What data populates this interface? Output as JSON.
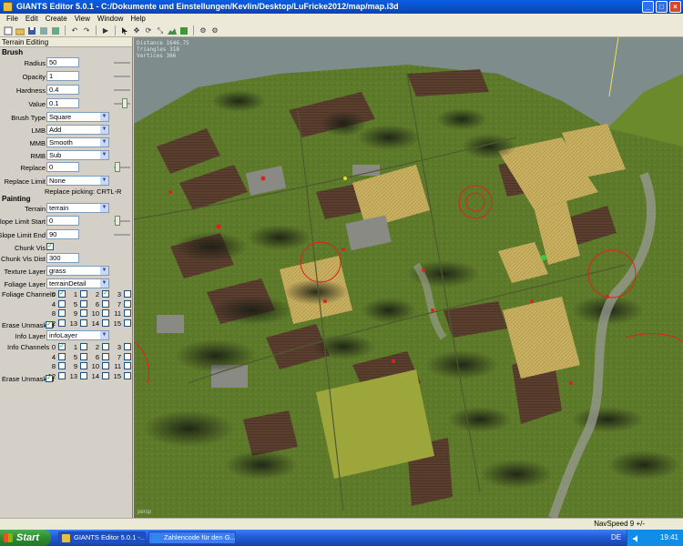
{
  "window": {
    "title": "GIANTS Editor 5.0.1 - C:/Dokumente und Einstellungen/Kevlin/Desktop/LuFricke2012/map/map.i3d",
    "controls": [
      "_",
      "□",
      "×"
    ]
  },
  "menu": [
    "File",
    "Edit",
    "Create",
    "View",
    "Window",
    "Help"
  ],
  "toolbar": {
    "icons": [
      "new-icon",
      "open-icon",
      "save-icon",
      "import-icon",
      "export-icon",
      "undo-icon",
      "redo-icon",
      "play-icon",
      "select-icon",
      "move-icon",
      "rotate-icon",
      "scale-icon",
      "terrain-icon",
      "paint-icon",
      "foliage-icon",
      "settings-icon"
    ]
  },
  "panel": {
    "title": "Terrain Editing",
    "brush_heading": "Brush",
    "radius_label": "Radius",
    "radius": "50",
    "opacity_label": "Opacity",
    "opacity": "1",
    "hardness_label": "Hardness",
    "hardness": "0.4",
    "value_label": "Value",
    "value": "0.1",
    "brush_type_label": "Brush Type",
    "brush_type": "Square",
    "lmb_label": "LMB",
    "lmb": "Add",
    "mmb_label": "MMB",
    "mmb": "Smooth",
    "rmb_label": "RMB",
    "rmb": "Sub",
    "replace_label": "Replace",
    "replace": "0",
    "replace_limit_label": "Replace Limit",
    "replace_limit": "None",
    "replace_picking": "Replace picking: CRTL-R",
    "painting_heading": "Painting",
    "terrain_label": "Terrain",
    "terrain": "terrain",
    "slope_start_label": "Slope Limit Start",
    "slope_start": "0",
    "slope_end_label": "Slope Limit End",
    "slope_end": "90",
    "chunk_vis_label": "Chunk Vis",
    "chunk_vis_dist_label": "Chunk Vis Dist",
    "chunk_vis_dist": "300",
    "texture_layer_label": "Texture Layer",
    "texture_layer": "grass",
    "foliage_layer_label": "Foliage Layer",
    "foliage_layer": "terrainDetail",
    "foliage_channels_label": "Foliage Channels",
    "foliage_channels": [
      "0",
      "1",
      "2",
      "3",
      "4",
      "5",
      "6",
      "7",
      "8",
      "9",
      "10",
      "11",
      "12",
      "13",
      "14",
      "15"
    ],
    "foliage_checked": [
      true,
      false,
      true,
      false,
      false,
      false,
      false,
      false,
      false,
      false,
      false,
      false,
      false,
      false,
      false,
      false
    ],
    "erase_unmasked_label": "Erase Unmasked",
    "info_layer_label": "Info Layer",
    "info_layer": "infoLayer",
    "info_channels_label": "Info Channels",
    "info_channels": [
      "0",
      "1",
      "2",
      "3",
      "4",
      "5",
      "6",
      "7",
      "8",
      "9",
      "10",
      "11",
      "12",
      "13",
      "14",
      "15"
    ],
    "info_checked": [
      true,
      false,
      false,
      false,
      false,
      false,
      false,
      false,
      false,
      false,
      false,
      false,
      false,
      false,
      false,
      false
    ],
    "erase_unmasked_label2": "Erase Unmasked"
  },
  "viewport": {
    "stats": [
      "Distance 1646.75",
      "Triangles 318",
      "Vertices 366"
    ],
    "camera_label": "persp"
  },
  "status": {
    "navspeed": "NavSpeed 9 +/-"
  },
  "taskbar": {
    "start": "Start",
    "tasks": [
      "GIANTS Editor 5.0.1 -...",
      "Zahlencode für den G..."
    ],
    "lang": "DE",
    "clock": "19:41"
  },
  "colors": {
    "titlebar": "#0b4fc8",
    "grass": "#5a7a2a",
    "wheat": "#c8b060",
    "plowed": "#5a3e2e",
    "marker": "#e02020"
  }
}
